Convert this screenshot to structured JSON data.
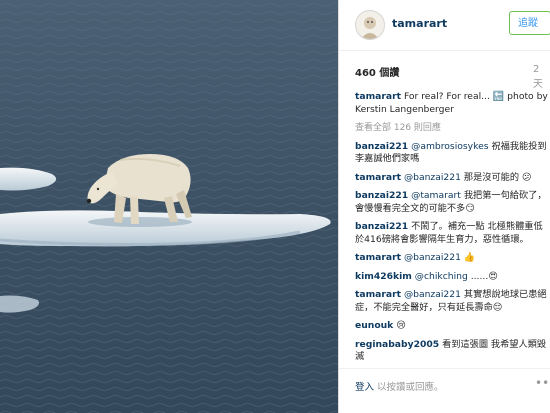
{
  "header": {
    "username": "tamarart",
    "follow_label": "追蹤"
  },
  "stats": {
    "views": "460 個讚",
    "timestamp": "2 天"
  },
  "caption": {
    "user": "tamarart",
    "text": "For real? For real... 🔚 photo by Kerstin Langenberger"
  },
  "load_more": "查看全部 126 則回應",
  "comments": [
    {
      "user": "banzai221",
      "mention": "@ambrosiosykes",
      "text": " 祝福我能投到李嘉誠他們家嗎"
    },
    {
      "user": "tamarart",
      "mention": "@banzai221",
      "text": " 那是沒可能的 😕"
    },
    {
      "user": "banzai221",
      "mention": "@tamarart",
      "text": " 我把第一句給砍了，會慢慢看完全文的可能不多😏"
    },
    {
      "user": "banzai221",
      "mention": "",
      "text": "不鬧了。補充一點 北極熊體重低於416磅將會影響隔年生育力，惡性循環。"
    },
    {
      "user": "tamarart",
      "mention": "@banzai221",
      "text": " 👍"
    },
    {
      "user": "kim426kim",
      "mention": "@chikching",
      "text": " ......😍"
    },
    {
      "user": "tamarart",
      "mention": "@banzai221",
      "text": " 其實想說地球已患絕症，不能完全醫好，只有延長壽命😔"
    },
    {
      "user": "eunouk",
      "mention": "",
      "text": "😢"
    },
    {
      "user": "reginababy2005",
      "mention": "",
      "text": "看到這張圖 我希望人類毀滅"
    }
  ],
  "footer": {
    "login_label": "登入",
    "rest": " 以按讚或回應。",
    "more_icon": "more-dots-icon"
  },
  "colors": {
    "link": "#0f3b61",
    "follow_border": "#70c050",
    "follow_text": "#3897f0",
    "sea": "#3f5366"
  }
}
